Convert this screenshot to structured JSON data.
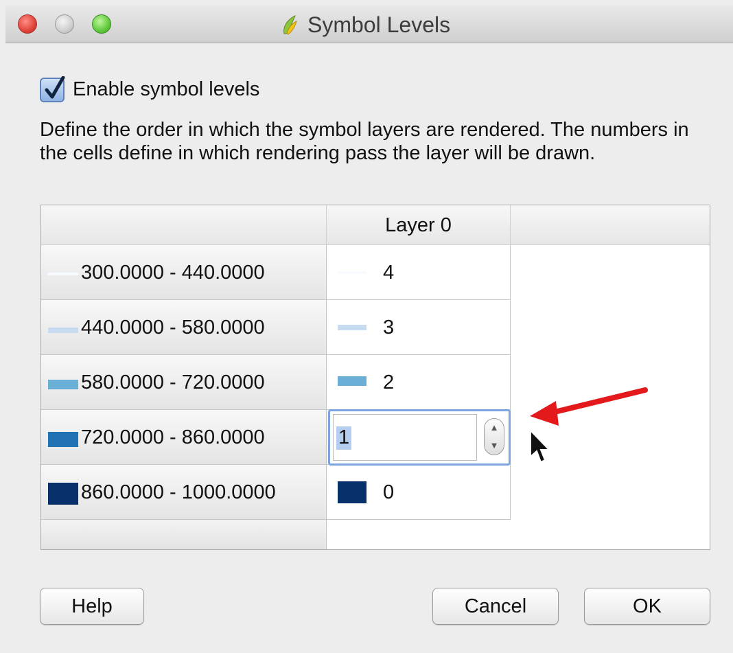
{
  "window": {
    "title": "Symbol Levels",
    "traffic_lights": [
      "close",
      "minimize",
      "zoom"
    ]
  },
  "enable_checkbox": {
    "label": "Enable symbol levels",
    "checked": true
  },
  "description": "Define the order in which the symbol layers are rendered. The numbers in the cells define in which rendering pass the layer will be drawn.",
  "table": {
    "column_header": "Layer 0",
    "rows": [
      {
        "label": "300.0000 - 440.0000",
        "color": "#f7fbff",
        "value": "4"
      },
      {
        "label": "440.0000 - 580.0000",
        "color": "#c6dbef",
        "value": "3"
      },
      {
        "label": "580.0000 - 720.0000",
        "color": "#6baed6",
        "value": "2"
      },
      {
        "label": "720.0000 - 860.0000",
        "color": "#2171b5",
        "value": "1"
      },
      {
        "label": "860.0000 - 1000.0000",
        "color": "#08306b",
        "value": "0"
      }
    ],
    "editing_row": 3
  },
  "annotation": {
    "arrow_color": "#e3191b"
  },
  "buttons": {
    "help": "Help",
    "cancel": "Cancel",
    "ok": "OK"
  }
}
